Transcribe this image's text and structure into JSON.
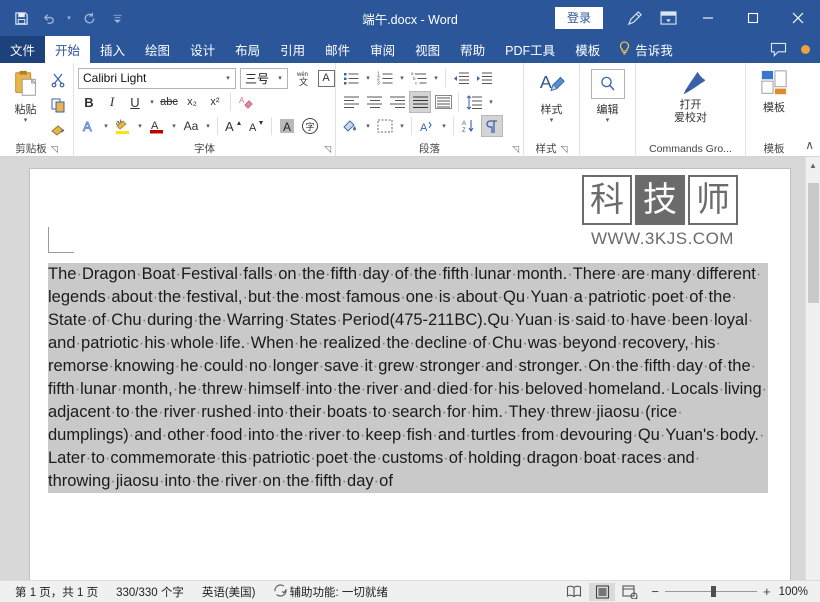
{
  "titlebar": {
    "quick_access": [
      {
        "name": "save-icon",
        "label": "保存"
      },
      {
        "name": "undo-icon",
        "label": "撤消"
      },
      {
        "name": "redo-icon",
        "label": "恢复"
      },
      {
        "name": "customize-quick-access-icon",
        "label": "自定义快速访问工具栏"
      }
    ],
    "title": "端午.docx  -  Word",
    "signin_label": "登录",
    "feedback_icon": "pen-feedback-icon",
    "ribbon_display_icon": "ribbon-display-options-icon",
    "minimize_label": "—",
    "maximize_label": "❐",
    "close_label": "✕"
  },
  "tabs": [
    {
      "label": "文件",
      "active": false,
      "file": true
    },
    {
      "label": "开始",
      "active": true,
      "file": false
    },
    {
      "label": "插入",
      "active": false,
      "file": false
    },
    {
      "label": "绘图",
      "active": false,
      "file": false
    },
    {
      "label": "设计",
      "active": false,
      "file": false
    },
    {
      "label": "布局",
      "active": false,
      "file": false
    },
    {
      "label": "引用",
      "active": false,
      "file": false
    },
    {
      "label": "邮件",
      "active": false,
      "file": false
    },
    {
      "label": "审阅",
      "active": false,
      "file": false
    },
    {
      "label": "视图",
      "active": false,
      "file": false
    },
    {
      "label": "帮助",
      "active": false,
      "file": false
    },
    {
      "label": "PDF工具",
      "active": false,
      "file": false
    },
    {
      "label": "模板",
      "active": false,
      "file": false
    }
  ],
  "tellme": {
    "label": "告诉我",
    "icon": "lightbulb-icon"
  },
  "comment_icon": "comment-icon",
  "ribbon": {
    "clipboard": {
      "paste_label": "粘贴",
      "group_label": "剪贴板",
      "cut_label": "剪切",
      "copy_label": "复制",
      "format_painter_label": "格式刷"
    },
    "font": {
      "font_name": "Calibri Light",
      "font_size": "三号",
      "phonetic_guide_label": "拼音指南",
      "enclose_border_label": "字符边框",
      "bold": "B",
      "italic": "I",
      "underline": "U",
      "strikethrough": "abc",
      "subscript": "x₂",
      "superscript": "x²",
      "clear_format_label": "清除所有格式",
      "text_effects": "A",
      "highlight": "ab",
      "font_color": "A",
      "change_case": "Aa",
      "grow_font": "A",
      "shrink_font": "A",
      "char_shading": "A",
      "enclose_characters": "字",
      "group_label": "字体"
    },
    "paragraph": {
      "group_label": "段落",
      "bullets_label": "项目符号",
      "numbering_label": "编号",
      "multilevel_label": "多级列表",
      "decrease_indent_label": "减少缩进量",
      "increase_indent_label": "增加缩进量",
      "align_left_label": "左对齐",
      "align_center_label": "居中",
      "align_right_label": "右对齐",
      "justify_label": "两端对齐",
      "distributed_label": "分散对齐",
      "line_spacing_label": "行和段落间距",
      "shading_label": "底纹",
      "borders_label": "边框",
      "asian_layout_label": "中文版式",
      "sort_label": "排序",
      "show_marks_label": "显示/隐藏编辑标记"
    },
    "styles": {
      "label": "样式",
      "group_label": "样式"
    },
    "editing": {
      "label": "编辑",
      "group_label": ""
    },
    "commands": {
      "line1": "打开",
      "line2": "爱校对",
      "group_label": "Commands Gro..."
    },
    "templates": {
      "label": "模板",
      "group_label": "模板"
    },
    "collapse_label": "∧"
  },
  "watermark": {
    "chars": [
      "科",
      "技",
      "师"
    ],
    "url": "WWW.3KJS.COM"
  },
  "document": {
    "body": "The Dragon Boat Festival falls on the fifth day of the fifth lunar month. There are many different legends about the festival, but the most famous one is about Qu Yuan a patriotic poet of the State of Chu during the Warring States Period(475-211BC).Qu Yuan is said to have been loyal and patriotic his whole life. When he realized the decline of Chu was beyond recovery, his remorse knowing he could no longer save it grew stronger and stronger. On the fifth day of the fifth lunar month, he threw himself into the river and died for his beloved homeland. Locals living adjacent to the river rushed into their boats to search for him. They threw jiaosu (rice dumplings) and other food into the river to keep fish and turtles from devouring Qu Yuan's body. Later to commemorate this patriotic poet the customs of holding dragon boat races and throwing jiaosu into the river on the fifth day of"
  },
  "statusbar": {
    "page": "第 1 页，共 1 页",
    "words": "330/330 个字",
    "language": "英语(美国)",
    "accessibility": "辅助功能: 一切就绪",
    "accessibility_icon": "accessibility-icon",
    "view_read_label": "阅读视图",
    "view_print_label": "页面视图",
    "view_web_label": "Web 版式视图",
    "zoom_out": "−",
    "zoom_in": "+",
    "zoom_value": "100%"
  }
}
